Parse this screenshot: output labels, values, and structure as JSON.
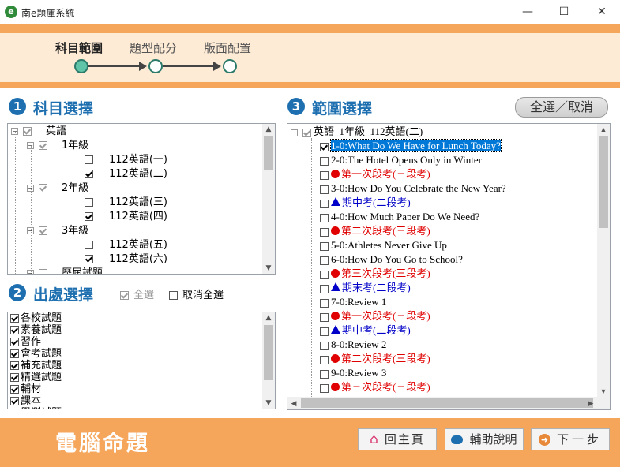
{
  "window": {
    "title": "南e題庫系統",
    "minimize": "—",
    "maximize": "☐",
    "close": "✕"
  },
  "stepper": {
    "steps": [
      "科目範圍",
      "題型配分",
      "版面配置"
    ]
  },
  "subject_panel": {
    "number": "1",
    "heading": "科目選擇",
    "tree": [
      {
        "label": "英語",
        "level": 0,
        "checked": true
      },
      {
        "label": "1年級",
        "level": 1,
        "checked": true
      },
      {
        "label": "112英語(一)",
        "level": 2,
        "checked": false
      },
      {
        "label": "112英語(二)",
        "level": 2,
        "checked": true
      },
      {
        "label": "2年級",
        "level": 1,
        "checked": true
      },
      {
        "label": "112英語(三)",
        "level": 2,
        "checked": false
      },
      {
        "label": "112英語(四)",
        "level": 2,
        "checked": true
      },
      {
        "label": "3年級",
        "level": 1,
        "checked": true
      },
      {
        "label": "112英語(五)",
        "level": 2,
        "checked": false
      },
      {
        "label": "112英語(六)",
        "level": 2,
        "checked": true
      },
      {
        "label": "歷屆試題",
        "level": 1,
        "checked": false
      }
    ]
  },
  "source_panel": {
    "number": "2",
    "heading": "出處選擇",
    "select_all": "全選",
    "deselect_all": "取消全選",
    "items": [
      "各校試題",
      "素養試題",
      "習作",
      "會考試題",
      "補充試題",
      "精選試題",
      "輔材",
      "課本",
      "學測試題"
    ]
  },
  "range_panel": {
    "number": "3",
    "heading": "範圍選擇",
    "toggle_button": "全選／取消",
    "root": "英語_1年級_112英語(二)",
    "items": [
      {
        "label": "1-0:What Do We Have for Lunch Today?",
        "kind": "lesson",
        "checked": true,
        "selected": true
      },
      {
        "label": "2-0:The Hotel Opens Only in Winter",
        "kind": "lesson",
        "checked": false
      },
      {
        "label": "第一次段考(三段考)",
        "kind": "red",
        "checked": false
      },
      {
        "label": "3-0:How Do You Celebrate the New Year?",
        "kind": "lesson",
        "checked": false
      },
      {
        "label": "期中考(二段考)",
        "kind": "blue",
        "checked": false
      },
      {
        "label": "4-0:How Much Paper Do We Need?",
        "kind": "lesson",
        "checked": false
      },
      {
        "label": "第二次段考(三段考)",
        "kind": "red",
        "checked": false
      },
      {
        "label": "5-0:Athletes Never Give Up",
        "kind": "lesson",
        "checked": false
      },
      {
        "label": "6-0:How Do You Go to School?",
        "kind": "lesson",
        "checked": false
      },
      {
        "label": "第三次段考(三段考)",
        "kind": "red",
        "checked": false
      },
      {
        "label": "期末考(二段考)",
        "kind": "blue",
        "checked": false
      },
      {
        "label": "7-0:Review 1",
        "kind": "lesson",
        "checked": false
      },
      {
        "label": "第一次段考(三段考)",
        "kind": "red",
        "checked": false
      },
      {
        "label": "期中考(二段考)",
        "kind": "blue",
        "checked": false
      },
      {
        "label": "8-0:Review 2",
        "kind": "lesson",
        "checked": false
      },
      {
        "label": "第二次段考(三段考)",
        "kind": "red",
        "checked": false
      },
      {
        "label": "9-0:Review 3",
        "kind": "lesson",
        "checked": false
      },
      {
        "label": "第三次段考(三段考)",
        "kind": "red",
        "checked": false
      }
    ]
  },
  "footer": {
    "title": "電腦命題",
    "home_button": "回主頁",
    "help_button": "輔助說明",
    "next_button": "下一步"
  },
  "colors": {
    "accent": "#f5a65b",
    "band_light": "#fdebd6",
    "heading_blue": "#1d6fb0",
    "selected": "#0078d7"
  }
}
